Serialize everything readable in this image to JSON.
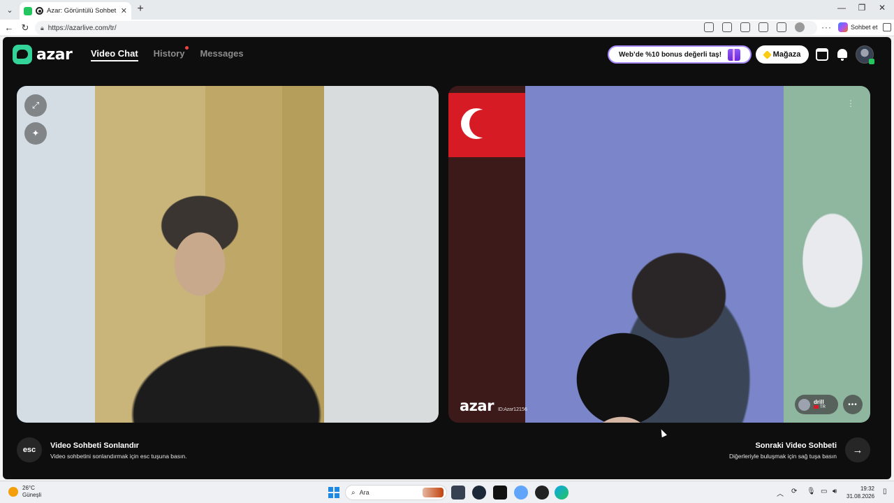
{
  "browser": {
    "tab_title": "Azar: Görüntülü Sohbet & Yeni",
    "url": "https://azarlive.com/tr/",
    "copilot_label": "Sohbet et"
  },
  "header": {
    "logo_text": "azar",
    "nav": [
      "Video Chat",
      "History",
      "Messages"
    ],
    "promo": "Web’de %10 bonus değerli taş!",
    "shop": "Mağaza"
  },
  "video": {
    "watermark": "azar",
    "watermark_sub": "ID:Azar12156",
    "peer_name": "drill",
    "peer_country": "TR"
  },
  "controls": {
    "end_key": "esc",
    "end_title": "Video Sohbeti Sonlandır",
    "end_sub": "Video sohbetini sonlandırmak için esc tuşuna basın.",
    "next_title": "Sonraki Video Sohbeti",
    "next_sub": "Diğerleriyle buluşmak için sağ tuşa basın"
  },
  "taskbar": {
    "temp": "26°C",
    "weather": "Güneşli",
    "search_placeholder": "Ara",
    "time": "19:32",
    "date": "31.08.2026"
  },
  "colors": {
    "page_bg": "#0e0e0f",
    "brand": "#34d399",
    "promo_border": "#a78bfa",
    "notification_dot": "#ef4444"
  }
}
